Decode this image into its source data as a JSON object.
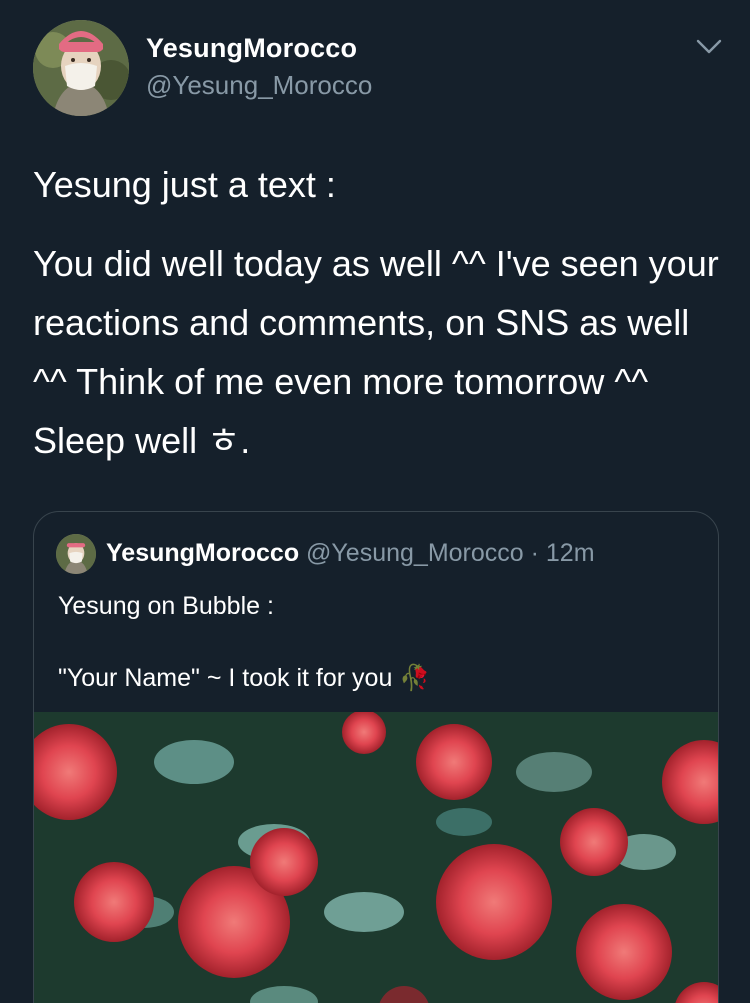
{
  "tweet": {
    "author": {
      "display_name": "YesungMorocco",
      "handle": "@Yesung_Morocco"
    },
    "menu_icon": "chevron-down-icon",
    "intro": "Yesung just a text :",
    "message": "You did well today as well ^^ I've seen your reactions and comments, on SNS as well ^^ Think of me even more tomorrow ^^ Sleep well ㅎ."
  },
  "quoted_tweet": {
    "display_name": "YesungMorocco",
    "handle": "@Yesung_Morocco",
    "separator": " · ",
    "time": "12m",
    "line1": "Yesung on Bubble :",
    "line2": "\"Your Name\" ~ I took it for you 🥀",
    "media": "photo of red roses"
  },
  "colors": {
    "background": "#15202b",
    "text": "#ffffff",
    "muted": "#8899a6",
    "border": "#38444d"
  }
}
